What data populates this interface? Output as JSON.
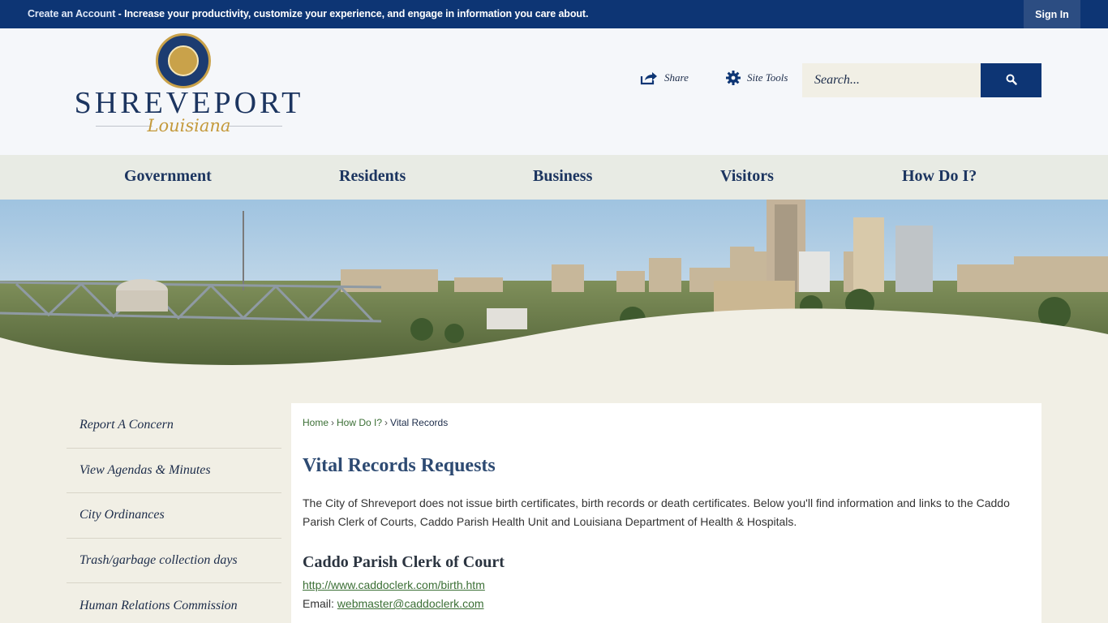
{
  "topbar": {
    "create_account_label": "Create an Account",
    "message": " - Increase your productivity, customize your experience, and engage in information you care about.",
    "signin_label": "Sign In"
  },
  "header": {
    "logo_word": "SHREVEPORT",
    "logo_script": "Louisiana",
    "share_label": "Share",
    "site_tools_label": "Site Tools",
    "search_placeholder": "Search..."
  },
  "nav": {
    "items": [
      {
        "label": "Government"
      },
      {
        "label": "Residents"
      },
      {
        "label": "Business"
      },
      {
        "label": "Visitors"
      },
      {
        "label": "How Do I?"
      }
    ]
  },
  "sidebar": {
    "items": [
      {
        "label": "Report A Concern"
      },
      {
        "label": "View Agendas & Minutes"
      },
      {
        "label": "City Ordinances"
      },
      {
        "label": "Trash/garbage collection days"
      },
      {
        "label": "Human Relations Commission"
      }
    ]
  },
  "breadcrumb": {
    "home": "Home",
    "how_do_i": "How Do I?",
    "current": "Vital Records",
    "separator": "›"
  },
  "content": {
    "title": "Vital Records Requests",
    "intro": "The City of Shreveport does not issue birth certificates, birth records or death certificates. Below you'll find information and links to the Caddo Parish Clerk of Courts, Caddo Parish Health Unit and Louisiana Department of Health & Hospitals.",
    "section_title": "Caddo Parish Clerk of Court",
    "section_link": "http://www.caddoclerk.com/birth.htm",
    "email_label": "Email: ",
    "email_value": "webmaster@caddoclerk.com"
  },
  "colors": {
    "brand_navy": "#0d3574",
    "gold": "#c9a24a",
    "link_green": "#3b6f35"
  },
  "icons": {
    "share": "share-icon",
    "site_tools": "gear-icon",
    "search": "search-icon"
  }
}
